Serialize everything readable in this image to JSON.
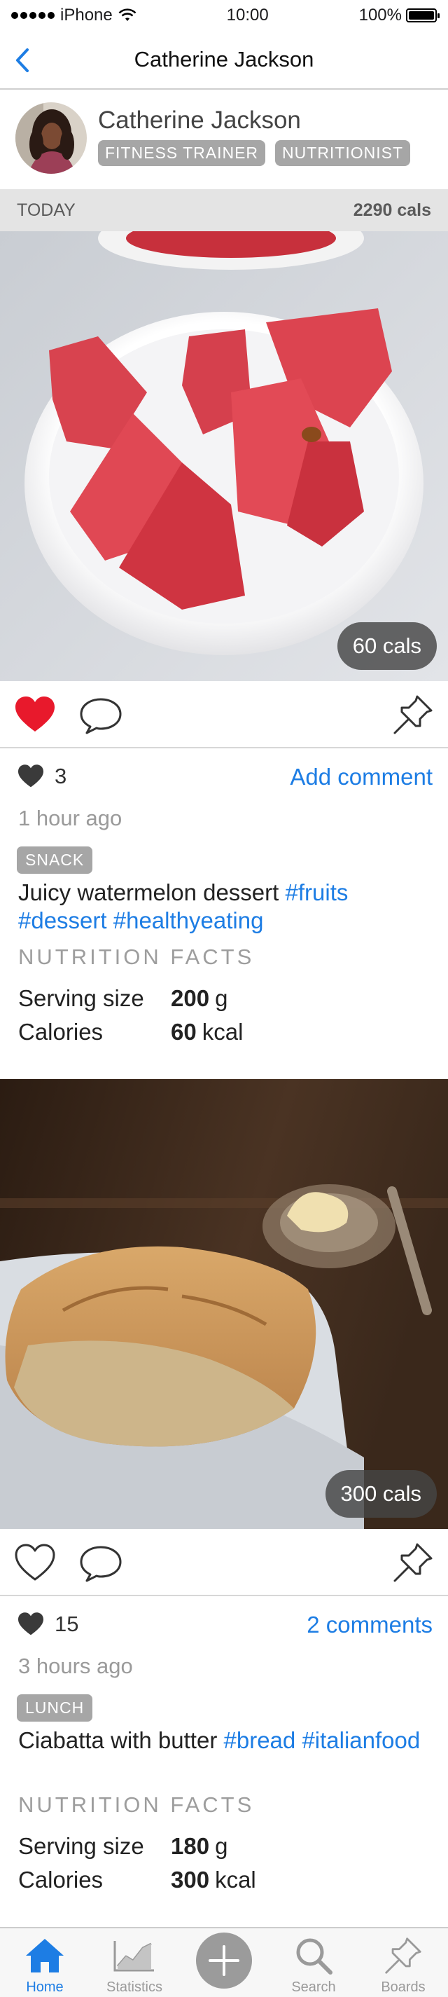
{
  "status_bar": {
    "carrier": "iPhone",
    "time": "10:00",
    "battery": "100%"
  },
  "nav": {
    "title": "Catherine Jackson"
  },
  "profile": {
    "name": "Catherine Jackson",
    "badges": [
      "FITNESS TRAINER",
      "NUTRITIONIST"
    ]
  },
  "today": {
    "label": "TODAY",
    "total": "2290 cals"
  },
  "posts": [
    {
      "calories_pill": "60 cals",
      "liked": true,
      "likes": "3",
      "comment_link": "Add comment",
      "time_ago": "1 hour ago",
      "tag": "SNACK",
      "description_text": "Juicy watermelon dessert",
      "hashtags": [
        "#fruits",
        "#dessert",
        "#healthyeating"
      ],
      "nutrition_title": "NUTRITION FACTS",
      "nutrition": [
        {
          "label": "Serving size",
          "value": "200",
          "unit": "g"
        },
        {
          "label": "Calories",
          "value": "60",
          "unit": "kcal"
        }
      ]
    },
    {
      "calories_pill": "300 cals",
      "liked": false,
      "likes": "15",
      "comment_link": "2 comments",
      "time_ago": "3 hours ago",
      "tag": "LUNCH",
      "description_text": "Ciabatta with butter",
      "hashtags": [
        "#bread",
        "#italianfood"
      ],
      "nutrition_title": "NUTRITION FACTS",
      "nutrition": [
        {
          "label": "Serving size",
          "value": "180",
          "unit": "g"
        },
        {
          "label": "Calories",
          "value": "300",
          "unit": "kcal"
        }
      ]
    }
  ],
  "tab_bar": {
    "tabs": [
      {
        "label": "Home",
        "icon": "home-icon"
      },
      {
        "label": "Statistics",
        "icon": "statistics-icon"
      },
      {
        "label": "",
        "icon": "plus-icon"
      },
      {
        "label": "Search",
        "icon": "search-icon"
      },
      {
        "label": "Boards",
        "icon": "pin-icon"
      }
    ]
  },
  "colors": {
    "accent": "#1d7de4",
    "like_red": "#e8192c",
    "badge_gray": "#a6a6a6"
  }
}
